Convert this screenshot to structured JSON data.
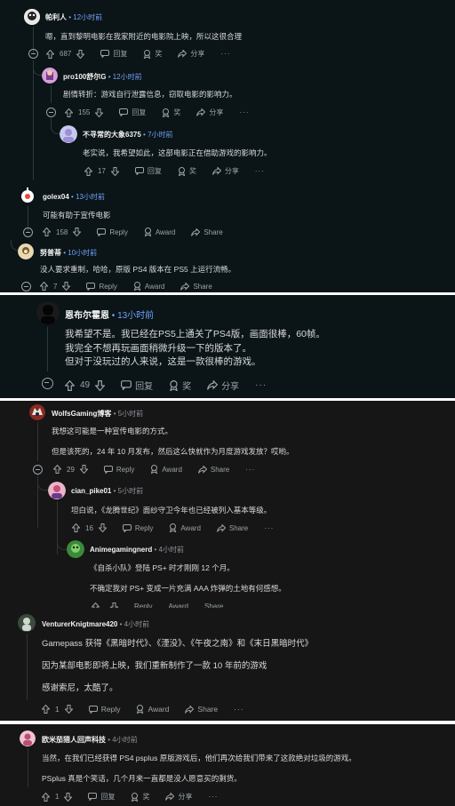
{
  "actions": {
    "reply": "回复",
    "award": "奖",
    "share": "分享",
    "reply_en": "Reply",
    "award_en": "Award",
    "share_en": "Share",
    "more": "···"
  },
  "p1": {
    "c1": {
      "user": "帕利人",
      "time": "12小时前",
      "text": "嗯，直到黎明电影在我家附近的电影院上映，所以这很合理",
      "votes": "687"
    },
    "c2": {
      "user": "pro100舒尔G",
      "time": "12小时前",
      "text": "剧情转折：游戏自行泄露信息，窃取电影的影响力。",
      "votes": "155"
    },
    "c3": {
      "user": "不寻常的大象6375",
      "time": "7小时前",
      "text": "老实说，我希望如此，这部电影正在借助游戏的影响力。",
      "votes": "17"
    },
    "c4": {
      "user": "golex04",
      "time": "13小时前",
      "text": "可能有助于宣传电影",
      "votes": "158"
    },
    "c5": {
      "user": "努普蒂",
      "time": "10小时前",
      "text": "没人要求重制，哈哈，原版 PS4 版本在 PS5 上运行流畅。",
      "votes": "7"
    }
  },
  "p2": {
    "user": "恩布尔霍恩",
    "time": "13小时前",
    "lines": [
      "我希望不是。我已经在PS5上通关了PS4版，画面很棒，60帧。",
      "我完全不想再玩画面稍微升级一下的版本了。",
      "但对于没玩过的人来说，这是一款很棒的游戏。"
    ],
    "votes": "49"
  },
  "p3": {
    "c1": {
      "user": "WolfsGaming博客",
      "time": "5小时前",
      "text1": "我想这可能是一种宣传电影的方式。",
      "text2": "但是该死的，24 年 10 月发布，然后这么快就作为月度游戏发放？哎哟。",
      "votes": "29"
    },
    "c2": {
      "user": "cian_pike01",
      "time": "5小时前",
      "text": "坦白说，《龙腾世纪》面纱守卫今年也已经被列入基本等级。",
      "votes": "16"
    },
    "c3": {
      "user": "Animegamingnerd",
      "time": "4小时前",
      "text1": "《自杀小队》登陆 PS+ 时才刚刚 12 个月。",
      "text2": "不确定我对 PS+ 变成一片充满 AAA 炸弹的土地有何感想。"
    },
    "c4": {
      "user": "VenturerKnigtmare420",
      "time": "4小时前",
      "text1": "Gamepass 获得《黑暗时代》、《湮没》、《午夜之南》和《末日黑暗时代》",
      "text2": "因为某部电影即将上映，我们重新制作了一款 10 年前的游戏",
      "text3": "感谢索尼，太酷了。",
      "votes": "1"
    }
  },
  "p4": {
    "user": "欧米茄猎人回声科技",
    "time": "4小时前",
    "text1": "当然，在我们已经获得 PS4 psplus 原版游戏后，他们再次给我们带来了这款绝对垃圾的游戏。",
    "text2": "PSplus 真是个笑话，几个月来一直都是没人愿意买的剩货。",
    "votes": "1"
  }
}
